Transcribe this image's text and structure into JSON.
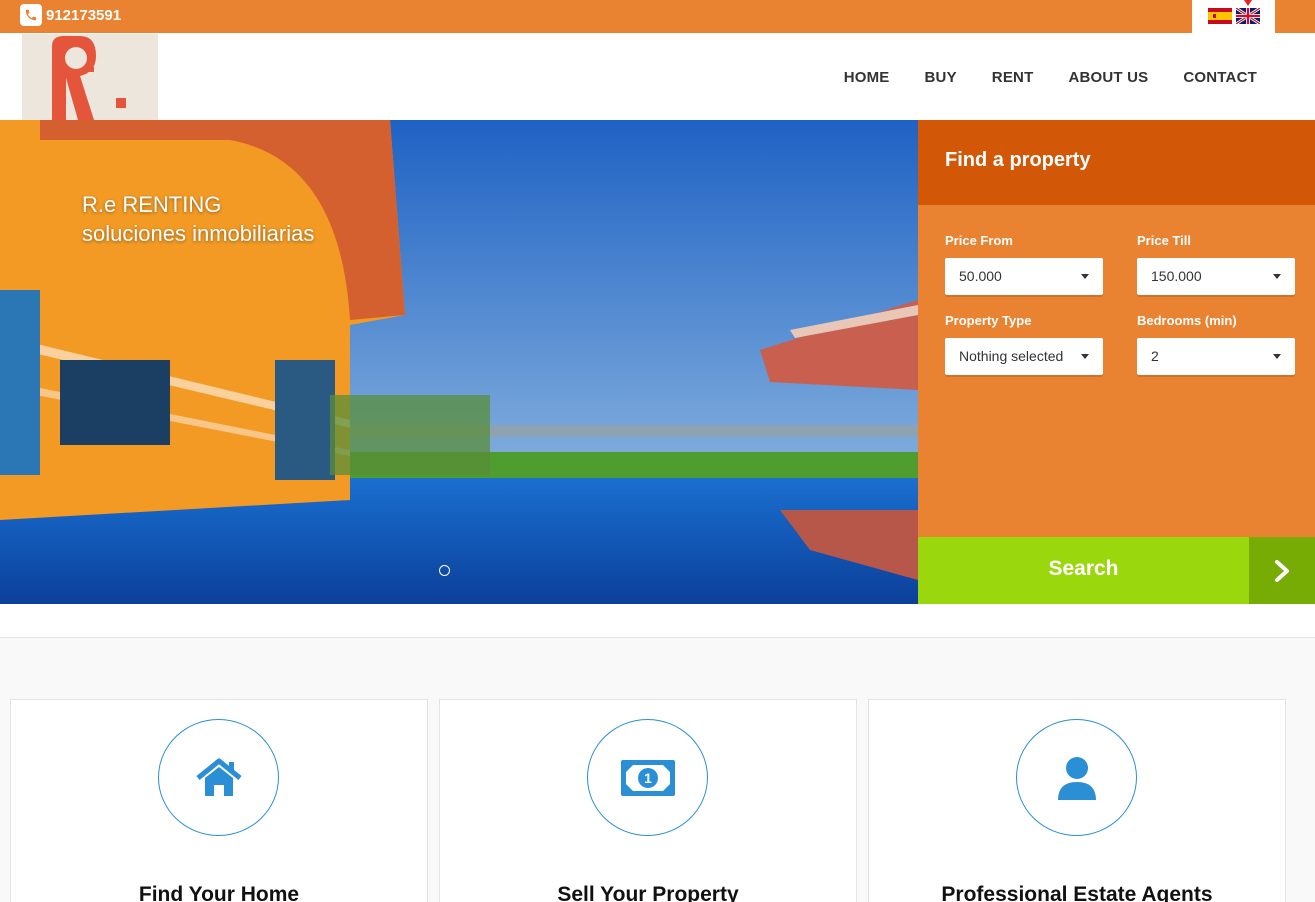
{
  "topbar": {
    "phone": "912173591",
    "languages": [
      "es",
      "en"
    ]
  },
  "nav": {
    "items": [
      "HOME",
      "BUY",
      "RENT",
      "ABOUT US",
      "CONTACT"
    ]
  },
  "hero": {
    "line1": "R.e RENTING",
    "line2": "soluciones inmobiliarias"
  },
  "search": {
    "title": "Find a property",
    "price_from_label": "Price From",
    "price_from_value": "50.000",
    "price_till_label": "Price Till",
    "price_till_value": "150.000",
    "property_type_label": "Property Type",
    "property_type_value": "Nothing selected",
    "bedrooms_label": "Bedrooms (min)",
    "bedrooms_value": "2",
    "button": "Search"
  },
  "features": [
    {
      "title": "Find Your Home",
      "icon": "home-icon"
    },
    {
      "title": "Sell Your Property",
      "icon": "banknote-icon"
    },
    {
      "title": "Professional Estate Agents",
      "icon": "user-icon"
    }
  ],
  "colors": {
    "brand_orange": "#e98231",
    "dark_orange": "#d25707",
    "search_green": "#9ad70c",
    "icon_blue": "#2b8fd6"
  }
}
